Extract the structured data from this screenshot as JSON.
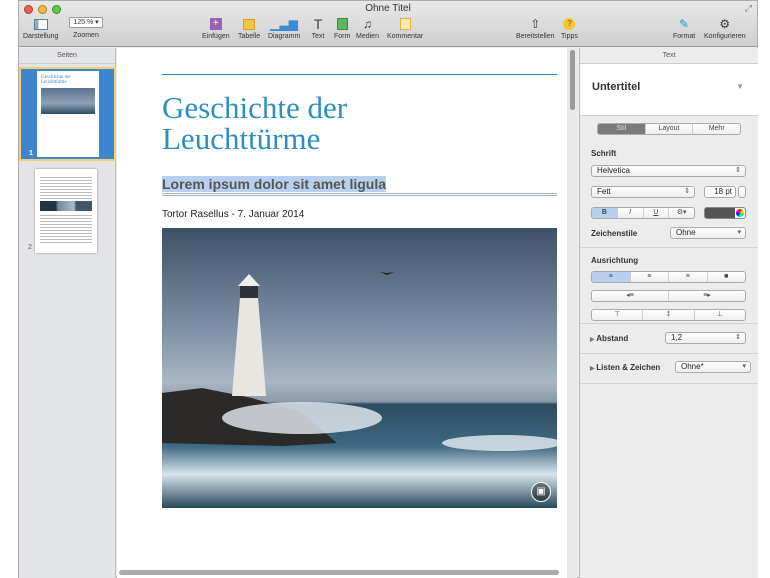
{
  "window": {
    "title": "Ohne Titel"
  },
  "toolbar": {
    "view": "Darstellung",
    "zoom_value": "125 %",
    "zoom": "Zoomen",
    "insert": "Einfügen",
    "table": "Tabelle",
    "chart": "Diagramm",
    "text": "Text",
    "shape": "Form",
    "media": "Medien",
    "comment": "Kommentar",
    "share": "Bereitstellen",
    "tips": "Tipps",
    "format": "Format",
    "setup": "Konfigurieren"
  },
  "sidebar": {
    "title": "Seiten",
    "pages": [
      {
        "number": "1"
      },
      {
        "number": "2"
      }
    ]
  },
  "document": {
    "title": "Geschichte der Leuchttürme",
    "subtitle": "Lorem ipsum dolor sit amet ligula",
    "byline": "Tortor Rasellus - 7. Januar 2014"
  },
  "inspector": {
    "header": "Text",
    "style_name": "Untertitel",
    "tabs": [
      "Stil",
      "Layout",
      "Mehr"
    ],
    "font_label": "Schrift",
    "font_family": "Helvetica",
    "font_weight": "Fett",
    "font_size": "18 pt",
    "bold": "B",
    "italic": "I",
    "underline": "U",
    "char_styles_label": "Zeichenstile",
    "char_styles_value": "Ohne",
    "alignment_label": "Ausrichtung",
    "spacing_label": "Abstand",
    "spacing_value": "1,2",
    "lists_label": "Listen & Zeichen",
    "lists_value": "Ohne*"
  },
  "colors": {
    "accent": "#2d8fbf",
    "selection": "#b8d0ee",
    "text_color": "#555555"
  }
}
